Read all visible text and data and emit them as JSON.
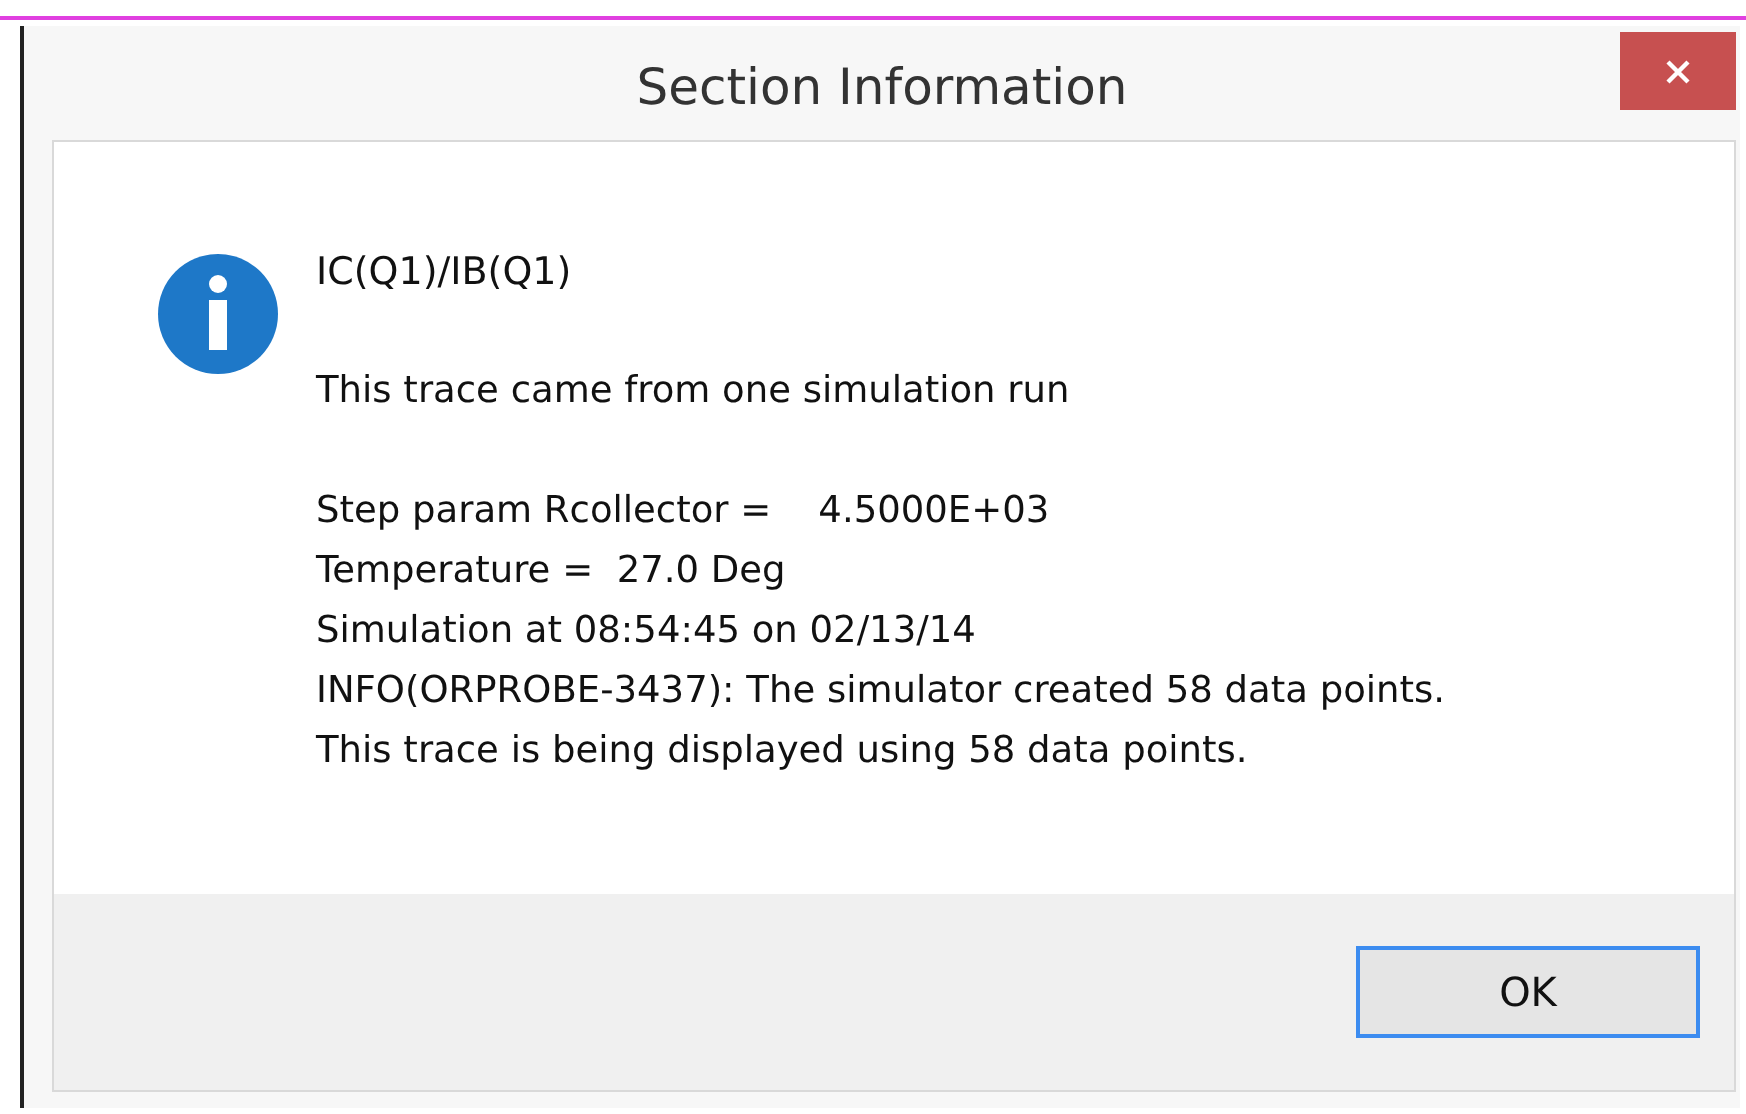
{
  "window": {
    "title": "Section Information"
  },
  "message": {
    "heading": "IC(Q1)/IB(Q1)",
    "summary": "This trace came from one simulation run",
    "details": [
      "Step param Rcollector =    4.5000E+03",
      "Temperature =  27.0 Deg",
      "Simulation at 08:54:45 on 02/13/14",
      "INFO(ORPROBE-3437): The simulator created 58 data points.",
      "This trace is being displayed using 58 data points."
    ]
  },
  "buttons": [
    {
      "label": "OK",
      "default": true
    }
  ]
}
